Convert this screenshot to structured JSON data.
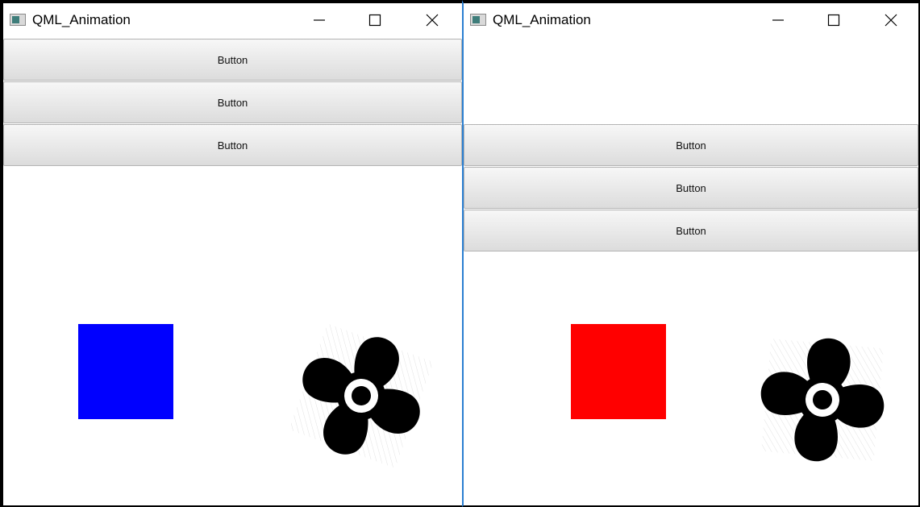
{
  "windows": [
    {
      "title": "QML_Animation",
      "buttons": [
        "Button",
        "Button",
        "Button"
      ],
      "square_color": "#0000ff",
      "fan_rotation_deg": 20
    },
    {
      "title": "QML_Animation",
      "buttons": [
        "Button",
        "Button",
        "Button"
      ],
      "square_color": "#ff0000",
      "fan_rotation_deg": 5
    }
  ],
  "icons": {
    "app": "qt-app-icon",
    "minimize": "minimize-icon",
    "maximize": "maximize-icon",
    "close": "close-icon",
    "fan": "propeller-fan-icon"
  }
}
